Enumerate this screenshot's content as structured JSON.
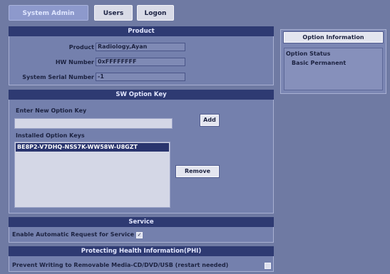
{
  "tabs": [
    {
      "label": "System Admin",
      "active": true
    },
    {
      "label": "Users",
      "active": false
    },
    {
      "label": "Logon",
      "active": false
    }
  ],
  "product": {
    "header": "Product",
    "fields": [
      {
        "label": "Product",
        "value": "Radiology,Ayan"
      },
      {
        "label": "HW Number",
        "value": "0xFFFFFFFF"
      },
      {
        "label": "System Serial Number",
        "value": "-1"
      }
    ]
  },
  "sw_option_key": {
    "header": "SW Option Key",
    "enter_label": "Enter New Option Key",
    "enter_value": "",
    "add_label": "Add",
    "installed_label": "Installed Option Keys",
    "installed_keys": [
      "BE8P2-V7DHQ-NSS7K-WW58W-U8GZT"
    ],
    "remove_label": "Remove"
  },
  "service": {
    "header": "Service",
    "label": "Enable Automatic Request for Service",
    "checked": true,
    "check_glyph": "✓"
  },
  "phi": {
    "header": "Protecting Health Information(PHI)",
    "label": "Prevent Writing to Removable Media-CD/DVD/USB (restart needed)",
    "checked": false,
    "check_glyph": ""
  },
  "option_information": {
    "header": "Option Information",
    "status_title": "Option Status",
    "status_value": "Basic Permanent"
  },
  "colors": {
    "background": "#6f7aa3",
    "header": "#2e3a72",
    "active_tab": "#8d99cc",
    "selection": "#29346e"
  }
}
